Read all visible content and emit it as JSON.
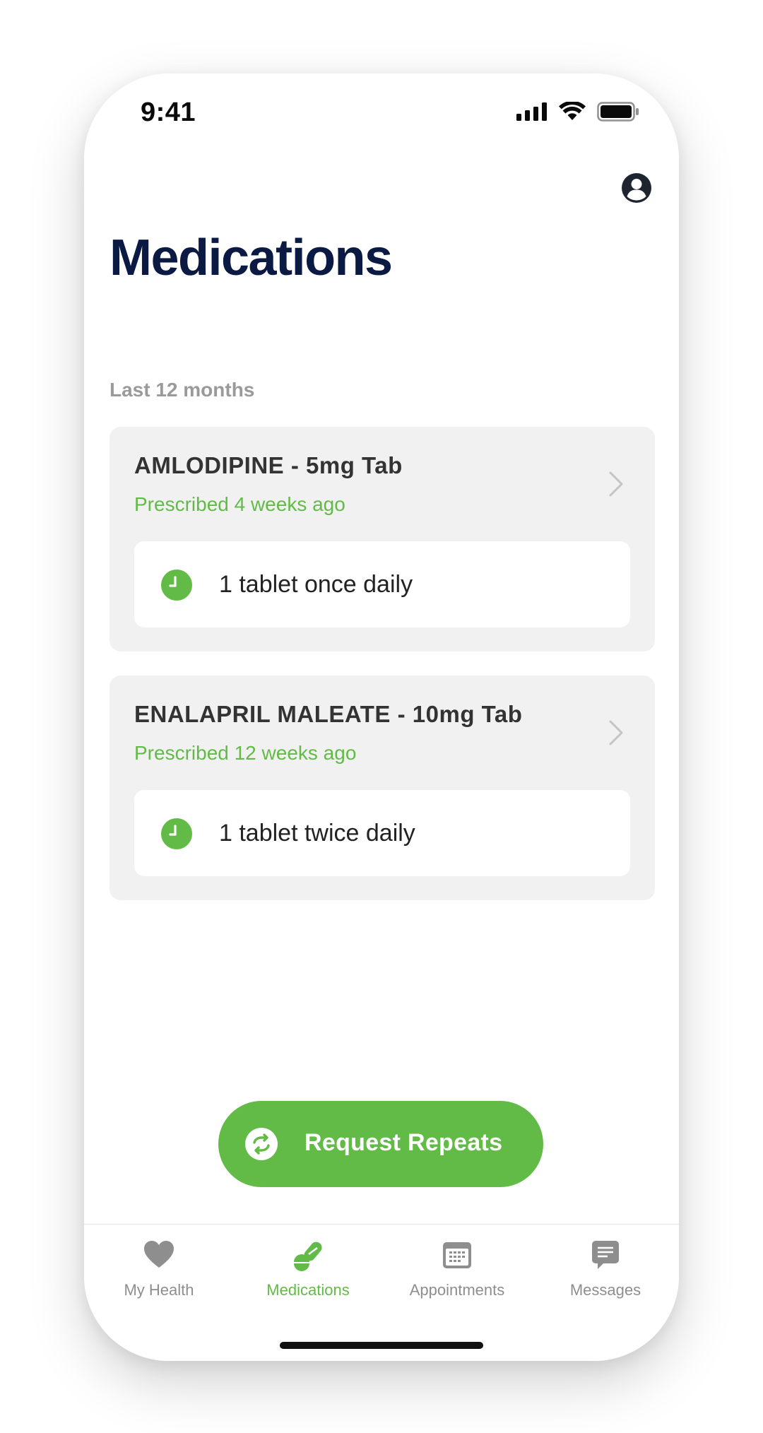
{
  "status_bar": {
    "time": "9:41"
  },
  "header": {
    "title": "Medications"
  },
  "section": {
    "label": "Last 12 months"
  },
  "medications": [
    {
      "name": "AMLODIPINE - 5mg Tab",
      "prescribed": "Prescribed 4 weeks ago",
      "dosage": "1 tablet once daily"
    },
    {
      "name": "ENALAPRIL MALEATE - 10mg Tab",
      "prescribed": "Prescribed 12 weeks ago",
      "dosage": "1 tablet twice daily"
    }
  ],
  "actions": {
    "request_label": "Request Repeats"
  },
  "tabs": [
    {
      "label": "My Health",
      "icon": "heart-icon",
      "active": false
    },
    {
      "label": "Medications",
      "icon": "pills-icon",
      "active": true
    },
    {
      "label": "Appointments",
      "icon": "calendar-icon",
      "active": false
    },
    {
      "label": "Messages",
      "icon": "message-icon",
      "active": false
    }
  ],
  "colors": {
    "accent": "#62bb47",
    "title": "#0b1a42",
    "card_bg": "#f1f1f1",
    "muted": "#9a9a9a"
  }
}
